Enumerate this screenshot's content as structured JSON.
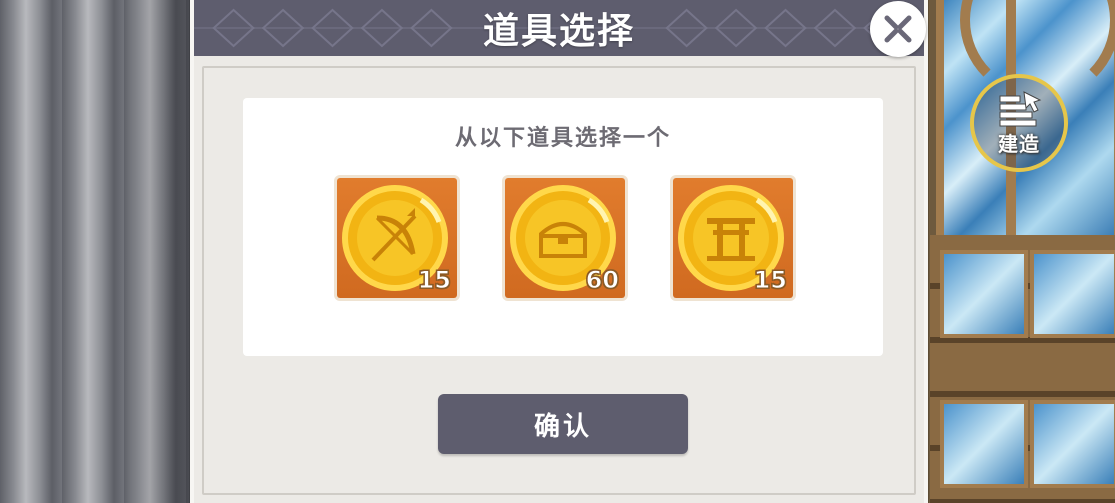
{
  "dialog": {
    "title": "道具选择",
    "instruction": "从以下道具选择一个",
    "confirm_label": "确认",
    "close_icon": "close-icon"
  },
  "items": [
    {
      "icon": "bow-coin-icon",
      "count": "15"
    },
    {
      "icon": "chest-coin-icon",
      "count": "60"
    },
    {
      "icon": "torii-coin-icon",
      "count": "15"
    }
  ],
  "hud": {
    "build_label": "建造",
    "build_icon": "build-icon"
  },
  "colors": {
    "header": "#5e5d6e",
    "dialog_bg": "#eceae6",
    "card_bg": "#ffffff",
    "slot_bg": "#d06a20",
    "coin_gold": "#f2b413",
    "build_ring": "#e6c64a"
  }
}
